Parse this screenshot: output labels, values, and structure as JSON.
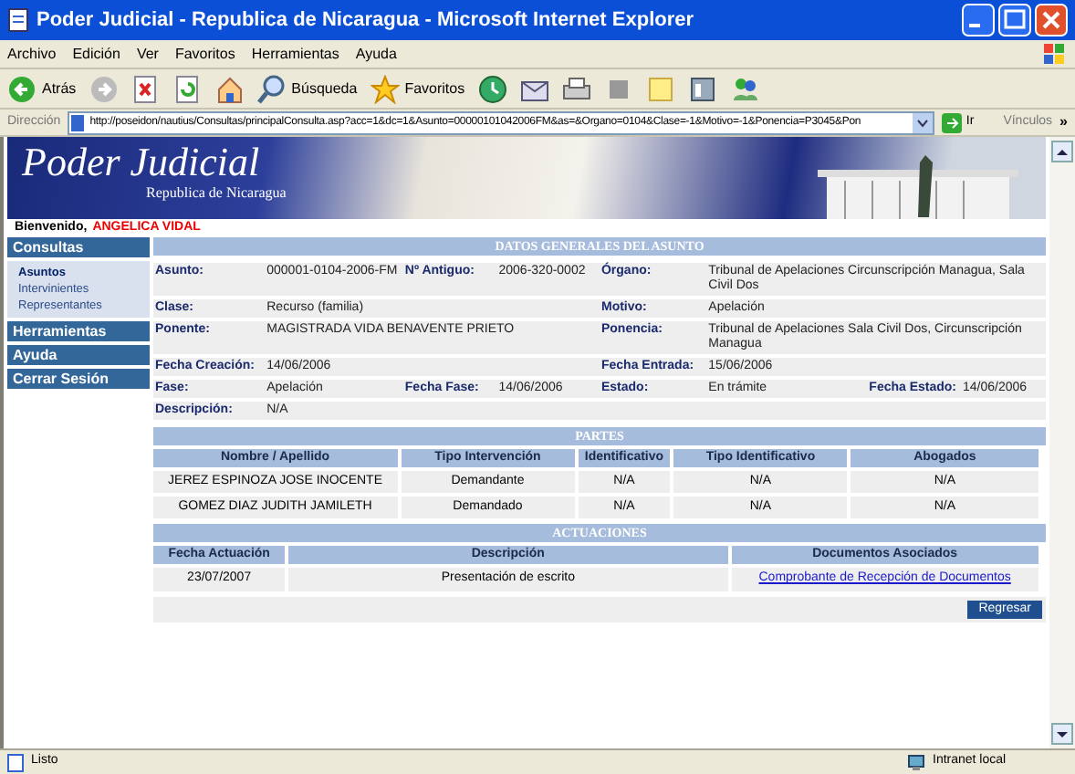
{
  "window": {
    "title": "Poder Judicial - Republica de Nicaragua - Microsoft Internet Explorer"
  },
  "menu": [
    "Archivo",
    "Edición",
    "Ver",
    "Favoritos",
    "Herramientas",
    "Ayuda"
  ],
  "toolbar": [
    {
      "kind": "back",
      "label": "Atrás"
    },
    {
      "kind": "forward"
    },
    {
      "kind": "stop"
    },
    {
      "kind": "refresh"
    },
    {
      "kind": "home"
    },
    {
      "kind": "search",
      "label": "Búsqueda"
    },
    {
      "kind": "favorites",
      "label": "Favoritos"
    },
    {
      "kind": "history"
    },
    {
      "kind": "mail"
    },
    {
      "kind": "print"
    },
    {
      "kind": "edit"
    },
    {
      "kind": "note"
    },
    {
      "kind": "tool"
    },
    {
      "kind": "messenger"
    }
  ],
  "address": {
    "label": "Dirección",
    "url": "http://poseidon/nautius/Consultas/principalConsulta.asp?acc=1&dc=1&Asunto=00000101042006FM&as=&Organo=0104&Clase=-1&Motivo=-1&Ponencia=P3045&Pon",
    "go": "Ir",
    "links": "Vínculos",
    "more": "»"
  },
  "banner": {
    "title": "Poder Judicial",
    "subtitle": "Republica de Nicaragua"
  },
  "welcome": {
    "label": "Bienvenido,",
    "user": "ANGELICA VIDAL"
  },
  "nav": [
    {
      "label": "Consultas",
      "children": [
        {
          "label": "Asuntos",
          "selected": true
        },
        {
          "label": "Intervinientes",
          "selected": false
        },
        {
          "label": "Representantes",
          "selected": false
        }
      ]
    },
    {
      "label": "Herramientas"
    },
    {
      "label": "Ayuda"
    },
    {
      "label": "Cerrar Sesión"
    }
  ],
  "datos": {
    "title": "DATOS GENERALES DEL ASUNTO",
    "rows": [
      {
        "left": [
          {
            "label": "Asunto:",
            "value": "000001-0104-2006-FM"
          },
          {
            "label": "Nº Antiguo:",
            "value": "2006-320-0002"
          }
        ],
        "right": [
          {
            "label": "Órgano:",
            "value": "Tribunal de Apelaciones Circunscripción Managua, Sala Civil Dos"
          }
        ]
      },
      {
        "left": [
          {
            "label": "Clase:",
            "value": "Recurso (familia)"
          }
        ],
        "right": [
          {
            "label": "Motivo:",
            "value": "Apelación"
          }
        ]
      },
      {
        "left": [
          {
            "label": "Ponente:",
            "value": "MAGISTRADA VIDA BENAVENTE PRIETO"
          }
        ],
        "right": [
          {
            "label": "Ponencia:",
            "value": "Tribunal de Apelaciones Sala Civil Dos, Circunscripción Managua"
          }
        ]
      },
      {
        "left": [
          {
            "label": "Fecha Creación:",
            "value": "14/06/2006"
          }
        ],
        "right": [
          {
            "label": "Fecha Entrada:",
            "value": "15/06/2006"
          }
        ]
      },
      {
        "left": [
          {
            "label": "Fase:",
            "value": "Apelación"
          },
          {
            "label": "Fecha Fase:",
            "value": "14/06/2006"
          }
        ],
        "right": [
          {
            "label": "Estado:",
            "value": "En trámite"
          },
          {
            "label": "Fecha Estado:",
            "value": "14/06/2006"
          }
        ]
      },
      {
        "left": [
          {
            "label": "Descripción:",
            "value": "N/A"
          }
        ],
        "right": []
      }
    ]
  },
  "partes": {
    "title": "PARTES",
    "columns": [
      "Nombre / Apellido",
      "Tipo Intervención",
      "Identificativo",
      "Tipo Identificativo",
      "Abogados"
    ],
    "rows": [
      [
        "JEREZ ESPINOZA JOSE INOCENTE",
        "Demandante",
        "N/A",
        "N/A",
        "N/A"
      ],
      [
        "GOMEZ DIAZ JUDITH JAMILETH",
        "Demandado",
        "N/A",
        "N/A",
        "N/A"
      ]
    ]
  },
  "actuaciones": {
    "title": "ACTUACIONES",
    "columns": [
      "Fecha Actuación",
      "Descripción",
      "Documentos Asociados"
    ],
    "rows": [
      {
        "date": "23/07/2007",
        "description": "Presentación de escrito",
        "document": "Comprobante de Recepción de Documentos"
      }
    ]
  },
  "back_button": "Regresar",
  "status_bar": {
    "text": "Listo",
    "zone": "Intranet local"
  }
}
